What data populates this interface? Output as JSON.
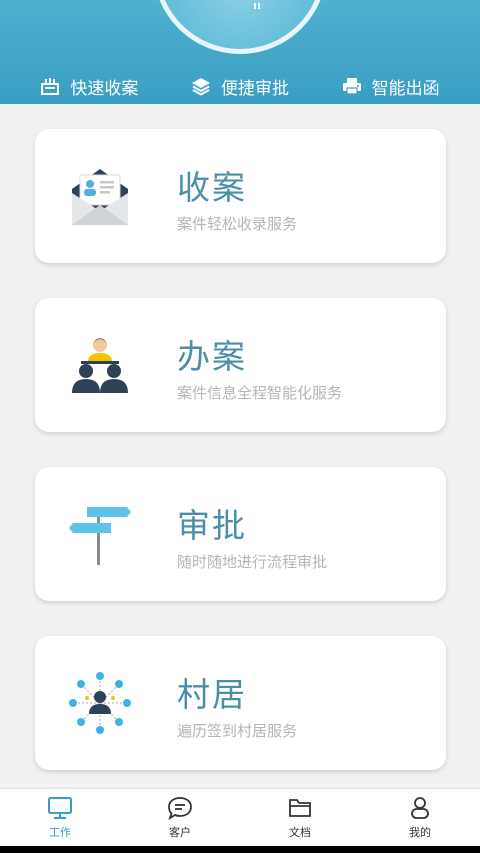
{
  "quick_bar": [
    {
      "label": "快速收案",
      "icon": "receipt-icon"
    },
    {
      "label": "便捷审批",
      "icon": "layers-icon"
    },
    {
      "label": "智能出函",
      "icon": "printer-icon"
    }
  ],
  "cards": [
    {
      "title": "收案",
      "desc": "案件轻松收录服务",
      "icon": "envelope-contact-icon"
    },
    {
      "title": "办案",
      "desc": "案件信息全程智能化服务",
      "icon": "people-meeting-icon"
    },
    {
      "title": "审批",
      "desc": "随时随地进行流程审批",
      "icon": "signpost-icon"
    },
    {
      "title": "村居",
      "desc": "遍历签到村居服务",
      "icon": "network-user-icon"
    }
  ],
  "tabs": [
    {
      "label": "工作",
      "icon": "monitor-icon",
      "active": true
    },
    {
      "label": "客户",
      "icon": "chat-icon"
    },
    {
      "label": "文档",
      "icon": "folder-icon"
    },
    {
      "label": "我的",
      "icon": "user-icon"
    }
  ],
  "colors": {
    "header": "#3a9ec3",
    "title": "#4c8eaa",
    "desc": "#b5b5b5",
    "active_tab": "#3a9ec3"
  }
}
